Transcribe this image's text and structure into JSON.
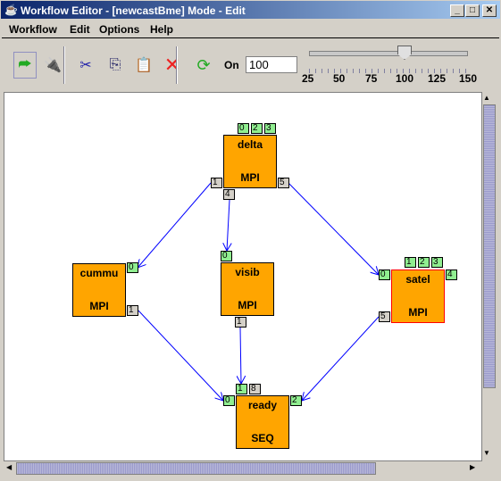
{
  "window": {
    "title": "Workflow Editor - [newcastBme]  Mode - Edit",
    "controls": [
      "minimize",
      "maximize",
      "close"
    ]
  },
  "menu": [
    "Workflow",
    "Edit",
    "Options",
    "Help"
  ],
  "toolbar": {
    "icons": [
      "new-workflow-icon",
      "plug-icon",
      "cut-icon",
      "copy-icon",
      "paste-icon",
      "delete-icon",
      "refresh-icon"
    ],
    "on_label": "On",
    "zoom_value": "100",
    "slider": {
      "min": 25,
      "max": 150,
      "value": 100,
      "labels": [
        "25",
        "50",
        "75",
        "100",
        "125",
        "150"
      ]
    }
  },
  "nodes": [
    {
      "name": "delta",
      "type": "MPI",
      "top_ports": [
        "0",
        "2",
        "3"
      ],
      "other_ports": [
        "1",
        "5",
        "4"
      ]
    },
    {
      "name": "cummu",
      "type": "MPI",
      "ports": [
        "0",
        "1"
      ]
    },
    {
      "name": "visib",
      "type": "MPI",
      "ports": [
        "0",
        "1"
      ]
    },
    {
      "name": "satel",
      "type": "MPI",
      "top_ports": [
        "1",
        "2",
        "3"
      ],
      "ports": [
        "4",
        "0",
        "5"
      ],
      "selected": true
    },
    {
      "name": "ready",
      "type": "SEQ",
      "ports": [
        "1",
        "8",
        "0",
        "2"
      ]
    }
  ],
  "edges": [
    [
      "delta:1",
      "cummu:0"
    ],
    [
      "delta:4",
      "visib:0"
    ],
    [
      "delta:5",
      "satel:0"
    ],
    [
      "cummu:1",
      "ready:0"
    ],
    [
      "visib:1",
      "ready:1"
    ],
    [
      "satel:5",
      "ready:2"
    ]
  ],
  "colors": {
    "node": "#ffa500",
    "input_port": "#90ee90",
    "output_port": "#d4d0c8",
    "edge": "#0000ff",
    "selected_border": "#ff0000"
  }
}
